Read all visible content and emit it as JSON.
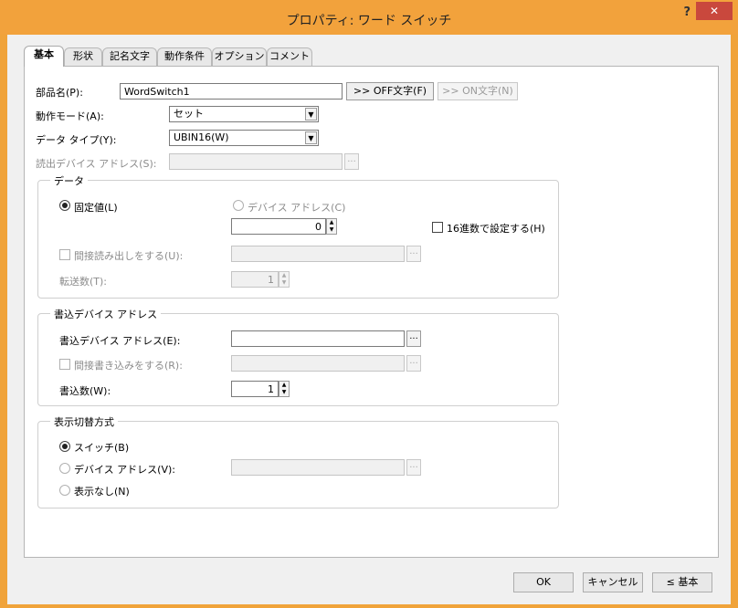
{
  "window": {
    "title": "プロパティ: ワード スイッチ",
    "help": "?",
    "close": "✕"
  },
  "tabs": [
    {
      "label": "基本",
      "active": true
    },
    {
      "label": "形状"
    },
    {
      "label": "記名文字"
    },
    {
      "label": "動作条件"
    },
    {
      "label": "オプション"
    },
    {
      "label": "コメント"
    }
  ],
  "form": {
    "part_name_label": "部品名(P):",
    "part_name_value": "WordSwitch1",
    "off_text_btn": ">> OFF文字(F)",
    "on_text_btn": ">> ON文字(N)",
    "mode_label": "動作モード(A):",
    "mode_value": "セット",
    "datatype_label": "データ タイプ(Y):",
    "datatype_value": "UBIN16(W)",
    "read_addr_label": "読出デバイス アドレス(S):",
    "read_addr_btn": "..."
  },
  "data_group": {
    "title": "データ",
    "fixed_label": "固定値(L)",
    "device_label": "デバイス アドレス(C)",
    "value": "0",
    "hex_label": "16進数で設定する(H)",
    "indirect_label": "間接読み出しをする(U):",
    "transfer_label": "転送数(T):",
    "transfer_value": "1",
    "btn": "..."
  },
  "write_group": {
    "title": "書込デバイス アドレス",
    "addr_label": "書込デバイス アドレス(E):",
    "indirect_label": "間接書き込みをする(R):",
    "count_label": "書込数(W):",
    "count_value": "1",
    "btn": "..."
  },
  "display_group": {
    "title": "表示切替方式",
    "switch_label": "スイッチ(B)",
    "device_label": "デバイス アドレス(V):",
    "none_label": "表示なし(N)",
    "btn": "..."
  },
  "footer": {
    "ok": "OK",
    "cancel": "キャンセル",
    "basic": "≤ 基本"
  }
}
